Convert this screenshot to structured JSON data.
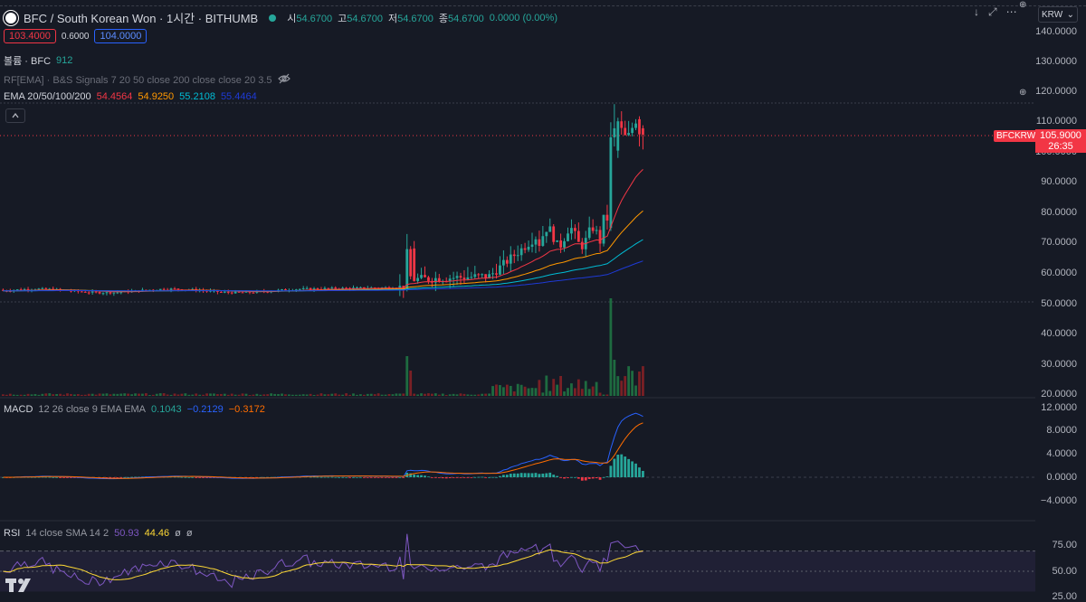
{
  "header": {
    "symbol_title": "BFC / South Korean Won · 1시간 · BITHUMB",
    "ohlc": [
      {
        "label": "시",
        "value": "54.6700"
      },
      {
        "label": "고",
        "value": "54.6700"
      },
      {
        "label": "저",
        "value": "54.6700"
      },
      {
        "label": "종",
        "value": "54.6700"
      }
    ],
    "change": "0.0000 (0.00%)",
    "sell_price": "103.4000",
    "spread": "0.6000",
    "buy_price": "104.0000",
    "currency": "KRW"
  },
  "indicators": {
    "volume": {
      "label": "볼륨 · BFC",
      "value": "912"
    },
    "rf": {
      "label": "RF[EMA] · B&S Signals 7 20 50 close 200 close close 20 3.5"
    },
    "ema": {
      "label": "EMA 20/50/100/200",
      "values": [
        "54.4564",
        "54.9250",
        "55.2108",
        "55.4464"
      ],
      "colors": [
        "#f23645",
        "#ff9800",
        "#00bcd4",
        "#1e3ad6"
      ]
    },
    "macd": {
      "label": "MACD",
      "params": "12 26 close 9 EMA EMA",
      "values": [
        "0.1043",
        "−0.2129",
        "−0.3172"
      ],
      "colors": [
        "#26a69a",
        "#2962ff",
        "#ff6d00"
      ]
    },
    "rsi": {
      "label": "RSI",
      "params": "14 close SMA 14 2",
      "values": [
        "50.93",
        "44.46",
        "ø",
        "ø"
      ],
      "colors": [
        "#7e57c2",
        "#fdd835",
        "#b2b5be",
        "#b2b5be"
      ]
    }
  },
  "price_axis": [
    "140.0000",
    "130.0000",
    "120.0000",
    "110.0000",
    "100.0000",
    "90.0000",
    "80.0000",
    "70.0000",
    "60.0000",
    "50.0000",
    "40.0000",
    "30.0000",
    "20.0000"
  ],
  "macd_axis": [
    "12.0000",
    "8.0000",
    "4.0000",
    "0.0000",
    "−4.0000"
  ],
  "rsi_axis": [
    "75.00",
    "50.00",
    "25.00"
  ],
  "current_price": {
    "symbol": "BFCKRW",
    "price": "105.9000",
    "countdown": "26:35"
  },
  "colors": {
    "up": "#26a69a",
    "down": "#f23645",
    "bg": "#161a25"
  }
}
